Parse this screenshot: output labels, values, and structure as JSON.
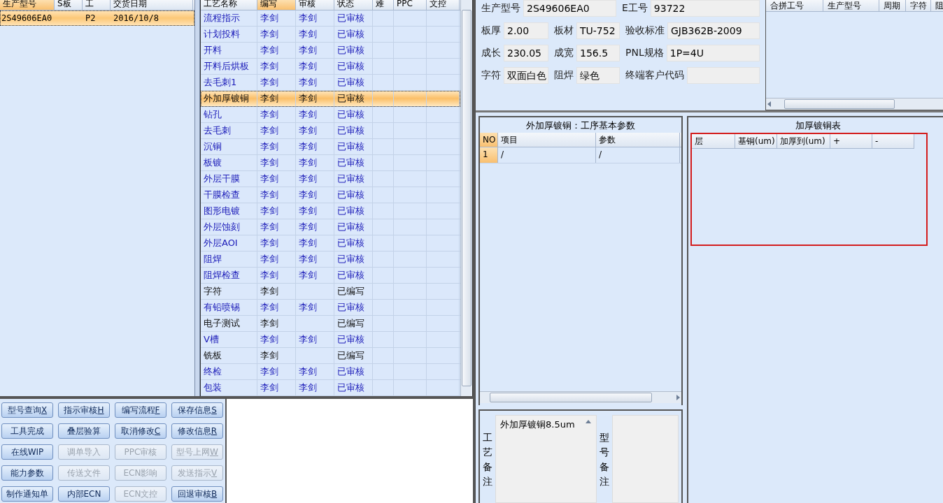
{
  "order_list": {
    "columns": [
      "生产型号",
      "S板",
      "工",
      "交货日期"
    ],
    "rows": [
      {
        "cells": [
          "2S49606EA0",
          "",
          "P2",
          "2016/10/8"
        ],
        "selected": true
      }
    ]
  },
  "process_table": {
    "columns": [
      "工艺名称",
      "编写",
      "审核",
      "状态",
      "难",
      "PPC",
      "文控"
    ],
    "rows": [
      {
        "cells": [
          "流程指示",
          "李剑",
          "李剑",
          "已审核"
        ],
        "audited": true,
        "selected": false
      },
      {
        "cells": [
          "计划投料",
          "李剑",
          "李剑",
          "已审核"
        ],
        "audited": true,
        "selected": false
      },
      {
        "cells": [
          "开料",
          "李剑",
          "李剑",
          "已审核"
        ],
        "audited": true,
        "selected": false
      },
      {
        "cells": [
          "开料后烘板",
          "李剑",
          "李剑",
          "已审核"
        ],
        "audited": true,
        "selected": false
      },
      {
        "cells": [
          "去毛刺1",
          "李剑",
          "李剑",
          "已审核"
        ],
        "audited": true,
        "selected": false
      },
      {
        "cells": [
          "外加厚镀铜",
          "李剑",
          "李剑",
          "已审核"
        ],
        "audited": true,
        "selected": true
      },
      {
        "cells": [
          "钻孔",
          "李剑",
          "李剑",
          "已审核"
        ],
        "audited": true,
        "selected": false
      },
      {
        "cells": [
          "去毛刺",
          "李剑",
          "李剑",
          "已审核"
        ],
        "audited": true,
        "selected": false
      },
      {
        "cells": [
          "沉铜",
          "李剑",
          "李剑",
          "已审核"
        ],
        "audited": true,
        "selected": false
      },
      {
        "cells": [
          "板镀",
          "李剑",
          "李剑",
          "已审核"
        ],
        "audited": true,
        "selected": false
      },
      {
        "cells": [
          "外层干膜",
          "李剑",
          "李剑",
          "已审核"
        ],
        "audited": true,
        "selected": false
      },
      {
        "cells": [
          "干膜检查",
          "李剑",
          "李剑",
          "已审核"
        ],
        "audited": true,
        "selected": false
      },
      {
        "cells": [
          "图形电镀",
          "李剑",
          "李剑",
          "已审核"
        ],
        "audited": true,
        "selected": false
      },
      {
        "cells": [
          "外层蚀刻",
          "李剑",
          "李剑",
          "已审核"
        ],
        "audited": true,
        "selected": false
      },
      {
        "cells": [
          "外层AOI",
          "李剑",
          "李剑",
          "已审核"
        ],
        "audited": true,
        "selected": false
      },
      {
        "cells": [
          "阻焊",
          "李剑",
          "李剑",
          "已审核"
        ],
        "audited": true,
        "selected": false
      },
      {
        "cells": [
          "阻焊检查",
          "李剑",
          "李剑",
          "已审核"
        ],
        "audited": true,
        "selected": false
      },
      {
        "cells": [
          "字符",
          "李剑",
          "",
          "已编写"
        ],
        "audited": false,
        "selected": false
      },
      {
        "cells": [
          "有铅喷锡",
          "李剑",
          "李剑",
          "已审核"
        ],
        "audited": true,
        "selected": false
      },
      {
        "cells": [
          "电子测试",
          "李剑",
          "",
          "已编写"
        ],
        "audited": false,
        "selected": false
      },
      {
        "cells": [
          "V槽",
          "李剑",
          "李剑",
          "已审核"
        ],
        "audited": true,
        "selected": false
      },
      {
        "cells": [
          "铣板",
          "李剑",
          "",
          "已编写"
        ],
        "audited": false,
        "selected": false
      },
      {
        "cells": [
          "终检",
          "李剑",
          "李剑",
          "已审核"
        ],
        "audited": true,
        "selected": false
      },
      {
        "cells": [
          "包装",
          "李剑",
          "李剑",
          "已审核"
        ],
        "audited": true,
        "selected": false
      }
    ]
  },
  "buttons": [
    {
      "label": "型号查询",
      "accel": "X",
      "disabled": false
    },
    {
      "label": "指示审核",
      "accel": "H",
      "disabled": false
    },
    {
      "label": "编写流程",
      "accel": "F",
      "disabled": false
    },
    {
      "label": "保存信息",
      "accel": "S",
      "disabled": false
    },
    {
      "label": "工具完成",
      "disabled": false
    },
    {
      "label": "叠层验算",
      "disabled": false
    },
    {
      "label": "取消修改",
      "accel": "C",
      "disabled": false
    },
    {
      "label": "修改信息",
      "accel": "R",
      "disabled": false
    },
    {
      "label": "在线WIP",
      "disabled": false
    },
    {
      "label": "调单导入",
      "disabled": true
    },
    {
      "label": "PPC审核",
      "disabled": true
    },
    {
      "label": "型号上网",
      "accel": "W",
      "disabled": true
    },
    {
      "label": "能力参数",
      "disabled": false
    },
    {
      "label": "传送文件",
      "disabled": true
    },
    {
      "label": "ECN影响",
      "disabled": true
    },
    {
      "label": "发送指示",
      "accel": "V",
      "disabled": true
    },
    {
      "label": "制作通知单",
      "disabled": false
    },
    {
      "label": "内部ECN",
      "disabled": false
    },
    {
      "label": "ECN文控",
      "disabled": true
    },
    {
      "label": "回退审核",
      "accel": "B",
      "disabled": false
    }
  ],
  "info": [
    [
      {
        "label": "生产型号",
        "value": "2S49606EA0"
      },
      {
        "label": "E工号",
        "value": "93722"
      }
    ],
    [
      {
        "label": "板厚",
        "value": "2.00"
      },
      {
        "label": "板材",
        "value": "TU-752"
      },
      {
        "label": "验收标准",
        "value": "GJB362B-2009"
      }
    ],
    [
      {
        "label": "成长",
        "value": "230.05"
      },
      {
        "label": "成宽",
        "value": "156.5"
      },
      {
        "label": "PNL规格",
        "value": "1P=4U"
      }
    ],
    [
      {
        "label": "字符",
        "value": "双面白色"
      },
      {
        "label": "阻焊",
        "value": "绿色"
      },
      {
        "label": "终端客户代码"
      }
    ]
  ],
  "merge_table": {
    "columns": [
      "合拼工号",
      "生产型号",
      "周期",
      "字符",
      "阻"
    ]
  },
  "params_panel": {
    "title": "外加厚镀铜：工序基本参数",
    "columns": [
      "NO",
      "项目",
      "参数"
    ],
    "rows": [
      [
        "1",
        "/",
        "/"
      ]
    ]
  },
  "remarks": [
    {
      "label": "工艺备注",
      "value": "外加厚镀铜8.5um"
    },
    {
      "label": "型号备注"
    }
  ],
  "copper_panel": {
    "title": "加厚镀铜表",
    "columns": [
      "层",
      "基铜(um)",
      "加厚到(um)",
      "+",
      "-"
    ],
    "highlighted": true
  }
}
